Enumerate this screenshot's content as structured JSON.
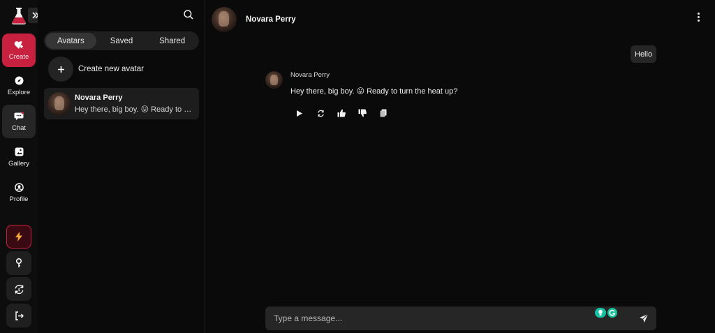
{
  "app": {
    "brand_color": "#c8203f"
  },
  "rail": {
    "items": [
      {
        "label": "Create",
        "icon": "heart-plus-icon"
      },
      {
        "label": "Explore",
        "icon": "compass-icon"
      },
      {
        "label": "Chat",
        "icon": "chat-bubble-icon"
      },
      {
        "label": "Gallery",
        "icon": "gallery-icon"
      },
      {
        "label": "Profile",
        "icon": "user-circle-icon"
      }
    ],
    "bottom_buttons": [
      "lightning-icon",
      "key-icon",
      "sync-icon",
      "logout-icon"
    ]
  },
  "panel": {
    "tabs": [
      "Avatars",
      "Saved",
      "Shared"
    ],
    "active_tab": "Avatars",
    "create_label": "Create new avatar",
    "chats": [
      {
        "name": "Novara Perry",
        "preview": "Hey there, big boy. 😛 Ready to turn the heat up?"
      }
    ]
  },
  "conversation": {
    "title": "Novara Perry",
    "user_message": "Hello",
    "bot_name": "Novara Perry",
    "bot_message": "Hey there, big boy. 😛 Ready to turn the heat up?",
    "actions": [
      "play-icon",
      "regenerate-icon",
      "thumbs-up-icon",
      "thumbs-down-icon",
      "copy-icon"
    ],
    "composer_placeholder": "Type a message..."
  }
}
